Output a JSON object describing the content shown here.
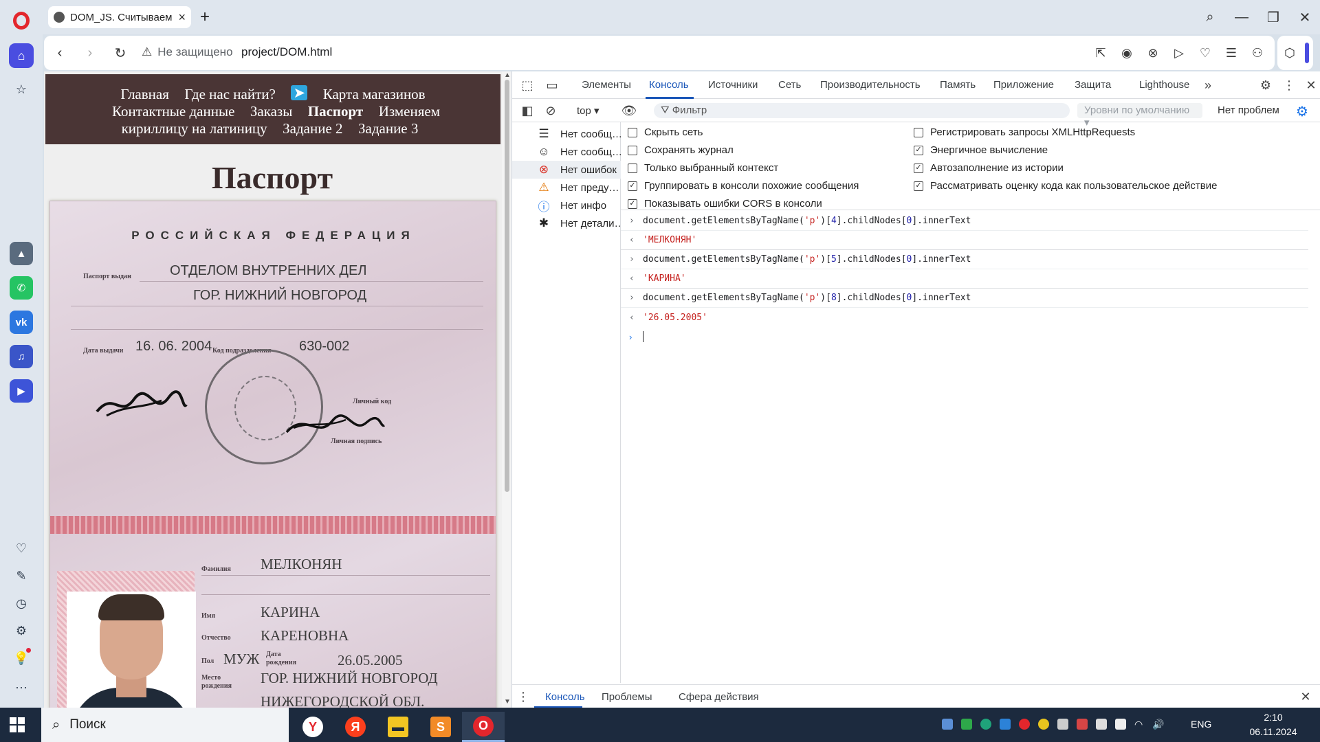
{
  "browser": {
    "tab_title": "DOM_JS. Считываем инф",
    "url_warning": "Не защищено",
    "url": "project/DOM.html"
  },
  "site": {
    "nav": [
      {
        "label": "Главная",
        "active": false
      },
      {
        "label": "Где нас найти?",
        "active": false
      },
      {
        "label": "Карта магазинов",
        "active": false
      },
      {
        "label": "Контактные данные",
        "active": false
      },
      {
        "label": "Заказы",
        "active": false
      },
      {
        "label": "Паспорт",
        "active": true
      },
      {
        "label": "Изменяем кириллицу на латиницу",
        "active": false
      },
      {
        "label": "Задание 2",
        "active": false
      },
      {
        "label": "Задание 3",
        "active": false
      }
    ],
    "heading": "Паспорт"
  },
  "passport": {
    "country": "РОССИЙСКАЯ  ФЕДЕРАЦИЯ",
    "issued_by_label": "Паспорт выдан",
    "issued_by_1": "ОТДЕЛОМ ВНУТРЕННИХ ДЕЛ",
    "issued_by_2": "ГОР.  НИЖНИЙ  НОВГОРОД",
    "date_label": "Дата выдачи",
    "issue_date": "16.  06.  2004",
    "code_label": "Код подразделения",
    "code": "630-002",
    "personal_code_label": "Личный код",
    "signature_label": "Личная подпись",
    "surname_label": "Фамилия",
    "surname": "МЕЛКОНЯН",
    "name_label": "Имя",
    "name": "КАРИНА",
    "patronymic_label": "Отчество",
    "patronymic": "КАРЕНОВНА",
    "sex_label": "Пол",
    "sex": "МУЖ",
    "birth_label_1": "Дата",
    "birth_label_2": "рождения",
    "birth_date": "26.05.2005",
    "place_label_1": "Место",
    "place_label_2": "рождения",
    "place_1": "ГОР.  НИЖНИЙ  НОВГОРОД",
    "place_2": "НИЖЕГОРОДСКОЙ ОБЛ."
  },
  "devtools": {
    "tabs": [
      "Элементы",
      "Консоль",
      "Источники",
      "Сеть",
      "Производительность",
      "Память",
      "Приложение",
      "Защита",
      "Lighthouse"
    ],
    "active_tab": "Консоль",
    "context": "top",
    "filter_placeholder": "Фильтр",
    "levels": "Уровни по умолчанию",
    "issues": "Нет проблем",
    "sidebar": [
      {
        "label": "Нет сообщ…",
        "icon": "list-icon"
      },
      {
        "label": "Нет сообщ…",
        "icon": "user-icon"
      },
      {
        "label": "Нет ошибок",
        "icon": "error-icon"
      },
      {
        "label": "Нет преду…",
        "icon": "warning-icon"
      },
      {
        "label": "Нет инфо",
        "icon": "info-icon"
      },
      {
        "label": "Нет детали…",
        "icon": "bug-icon"
      }
    ],
    "settings_left": [
      {
        "label": "Скрыть сеть",
        "checked": false
      },
      {
        "label": "Сохранять журнал",
        "checked": false
      },
      {
        "label": "Только выбранный контекст",
        "checked": false
      },
      {
        "label": "Группировать в консоли похожие сообщения",
        "checked": true
      },
      {
        "label": "Показывать ошибки CORS в консоли",
        "checked": true
      }
    ],
    "settings_right": [
      {
        "label": "Регистрировать запросы XMLHttpRequests",
        "checked": false
      },
      {
        "label": "Энергичное вычисление",
        "checked": true
      },
      {
        "label": "Автозаполнение из истории",
        "checked": true
      },
      {
        "label": "Рассматривать оценку кода как пользовательское действие",
        "checked": true
      }
    ],
    "console": [
      {
        "kind": "in",
        "pre": "document.getElementsByTagName(",
        "str": "'p'",
        "mid": ")[",
        "idx": "4",
        "post": "].childNodes[",
        "idx2": "0",
        "end": "].innerText"
      },
      {
        "kind": "out",
        "value": "'МЕЛКОНЯН'"
      },
      {
        "kind": "in",
        "pre": "document.getElementsByTagName(",
        "str": "'p'",
        "mid": ")[",
        "idx": "5",
        "post": "].childNodes[",
        "idx2": "0",
        "end": "].innerText"
      },
      {
        "kind": "out",
        "value": "'КАРИНА'"
      },
      {
        "kind": "in",
        "pre": "document.getElementsByTagName(",
        "str": "'p'",
        "mid": ")[",
        "idx": "8",
        "post": "].childNodes[",
        "idx2": "0",
        "end": "].innerText"
      },
      {
        "kind": "out",
        "value": "'26.05.2005'"
      }
    ],
    "drawer_tabs": [
      "Консоль",
      "Проблемы",
      "Сфера действия"
    ]
  },
  "taskbar": {
    "search_placeholder": "Поиск",
    "lang": "ENG",
    "time": "2:10",
    "date": "06.11.2024"
  },
  "colors": {
    "accent": "#1a56b8",
    "opera_red": "#e3262c",
    "site_nav_bg": "#4a3535"
  }
}
